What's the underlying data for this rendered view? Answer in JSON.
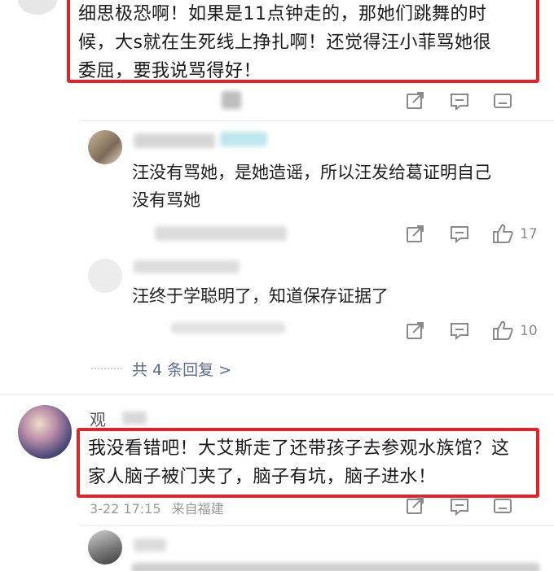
{
  "comment1": {
    "lines": [
      "细思极恐啊！如果是11点钟走的，那她们跳舞的时",
      "候，大s就在生死线上挣扎啊！还觉得汪小菲骂她很",
      "委屈，要我说骂得好！"
    ]
  },
  "reply1": {
    "lines": [
      "汪没有骂她，是她造谣，所以汪发给葛证明自己",
      "没有骂她"
    ],
    "like_count": "17"
  },
  "reply2": {
    "text": "汪终于学聪明了，知道保存证据了",
    "like_count": "10"
  },
  "replies_link": "共 4 条回复 >",
  "comment2": {
    "username": "观",
    "lines": [
      "我没看错吧！大艾斯走了还带孩子去参观水族馆？这",
      "家人脑子被门夹了，脑子有坑，脑子进水！"
    ],
    "timestamp": "3-22 17:15",
    "location": "来自福建"
  },
  "icons": {
    "share": "share-icon",
    "comment": "comment-icon",
    "like": "thumbs-up-icon"
  },
  "colors": {
    "highlight_border": "#e0242b",
    "meta_text": "#9a9a9a"
  }
}
